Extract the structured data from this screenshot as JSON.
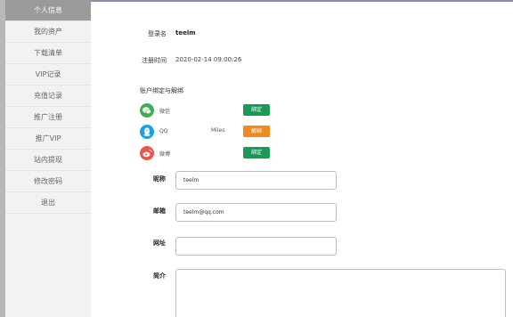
{
  "sidebar": {
    "items": [
      {
        "label": "个人信息"
      },
      {
        "label": "我的资产"
      },
      {
        "label": "下载清单"
      },
      {
        "label": "VIP记录"
      },
      {
        "label": "充值记录"
      },
      {
        "label": "推广注册"
      },
      {
        "label": "推广VIP"
      },
      {
        "label": "站内提现"
      },
      {
        "label": "修改密码"
      },
      {
        "label": "退出"
      }
    ],
    "active_index": 0
  },
  "profile": {
    "username_label": "登录名",
    "username_value": "teelm",
    "regtime_label": "注册时间",
    "regtime_value": "2020-02-14 09:00:26",
    "binding_title": "账户绑定与解绑"
  },
  "bindings": [
    {
      "name": "微信",
      "icon": "wechat-icon",
      "user": "",
      "button": "绑定",
      "color": "#1a9a5a"
    },
    {
      "name": "QQ",
      "icon": "qq-icon",
      "user": "Miles",
      "button": "解绑",
      "color": "#f08a1c"
    },
    {
      "name": "微博",
      "icon": "weibo-icon",
      "user": "",
      "button": "绑定",
      "color": "#1a9a5a"
    }
  ],
  "form": {
    "nickname_label": "昵称",
    "nickname_value": "teelm",
    "email_label": "邮箱",
    "email_value": "teelm@qq.com",
    "website_label": "网址",
    "website_value": "",
    "bio_label": "简介",
    "bio_value": ""
  }
}
